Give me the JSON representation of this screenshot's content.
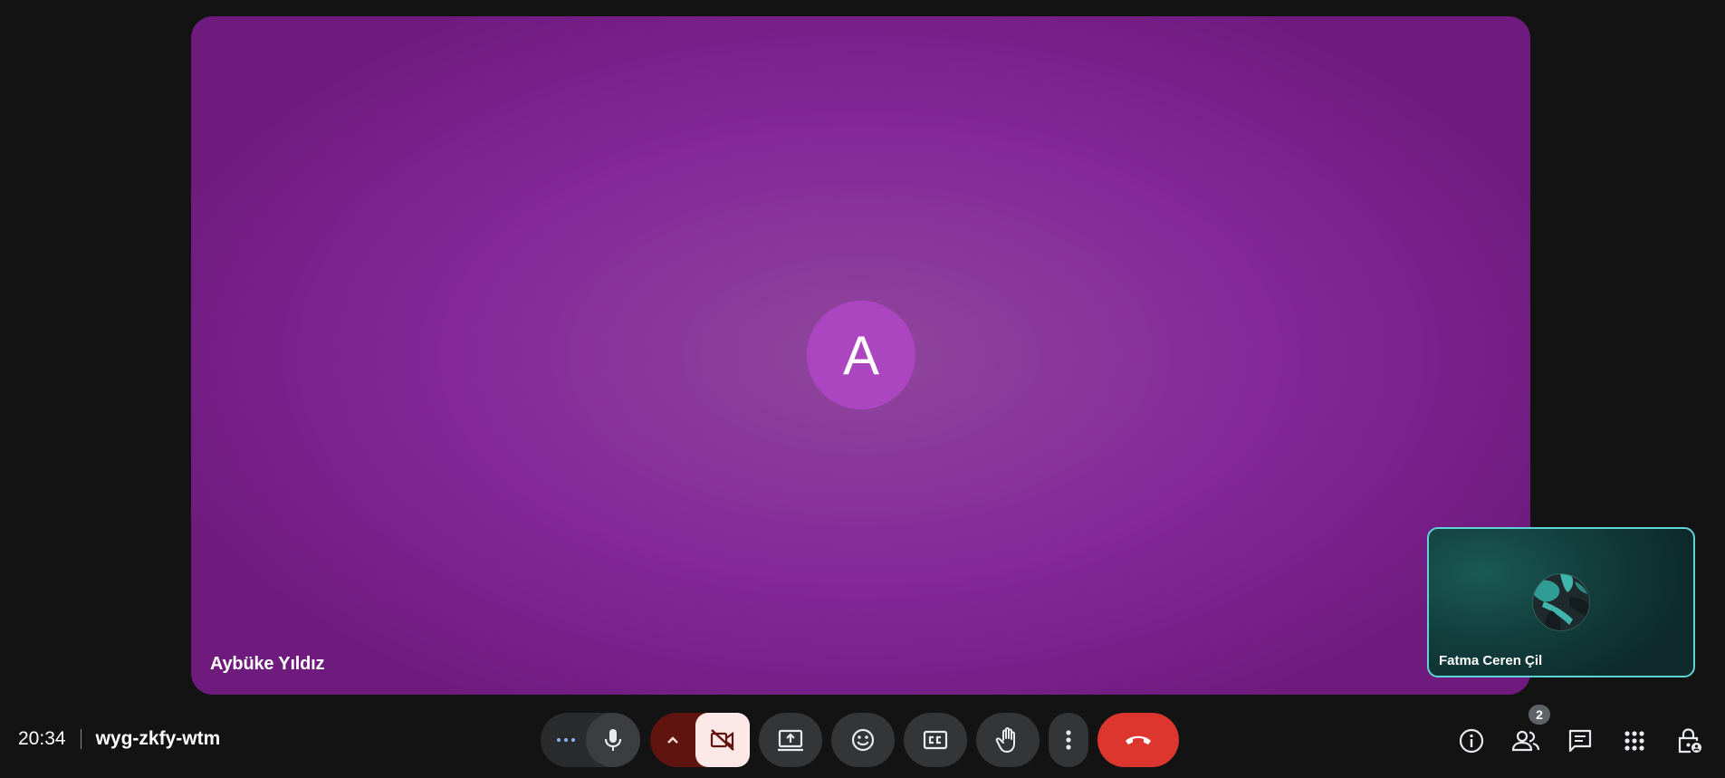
{
  "meeting": {
    "time": "20:34",
    "code": "wyg-zkfy-wtm"
  },
  "main_tile": {
    "participant_name": "Aybüke Yıldız",
    "avatar_initial": "A",
    "avatar_color": "#ac46c0",
    "background_color": "#84289a"
  },
  "self_tile": {
    "participant_name": "Fatma Ceren Çil",
    "border_color": "#5ed4d7"
  },
  "people_count": "2",
  "colors": {
    "leave_button": "#dc362e",
    "camera_off_bg": "#fce8e6",
    "camera_off_chevron_bg": "#601410",
    "control_bg": "#333537"
  },
  "controls": [
    "more-options-dots",
    "microphone",
    "camera-options",
    "camera-off",
    "present-screen",
    "reactions",
    "captions",
    "raise-hand",
    "more-options",
    "leave-call"
  ],
  "side_icons": [
    "meeting-details",
    "people",
    "chat",
    "activities",
    "host-controls"
  ]
}
